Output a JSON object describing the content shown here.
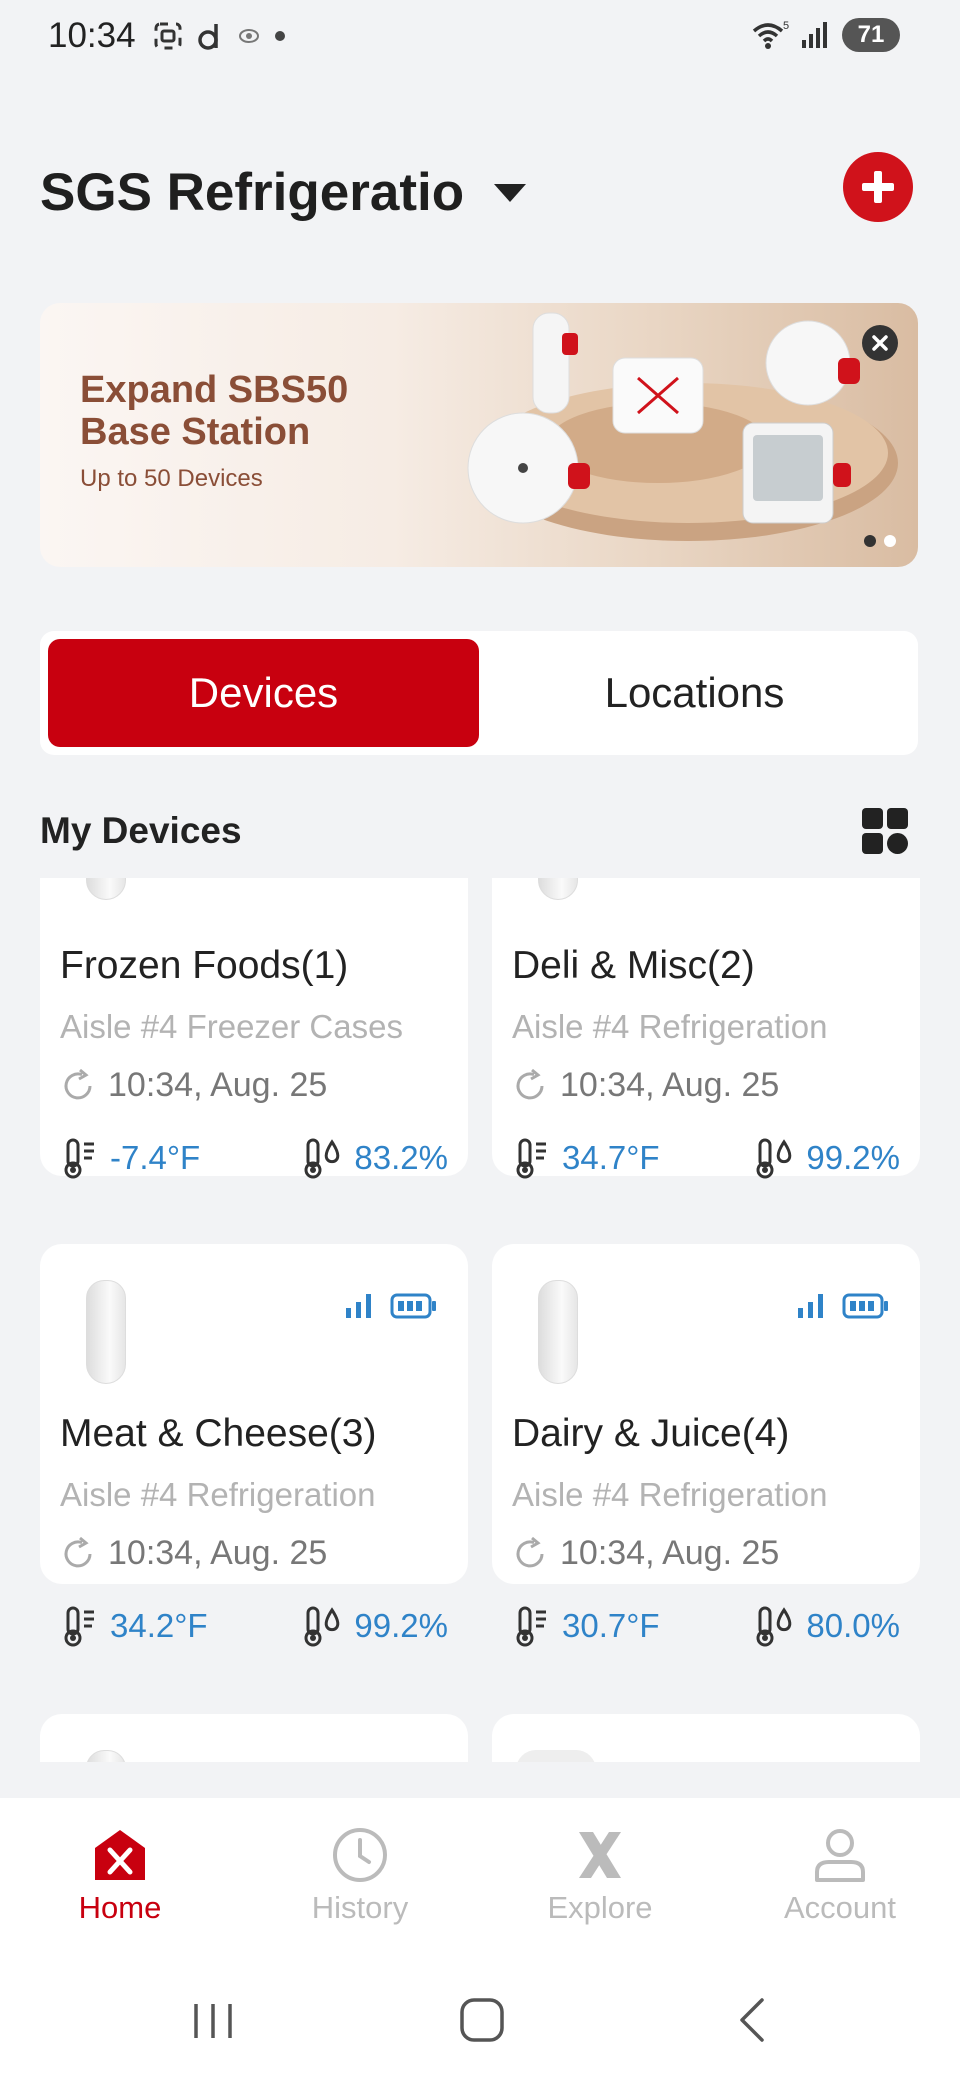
{
  "status_bar": {
    "time": "10:34",
    "battery": "71"
  },
  "header": {
    "title": "SGS Refrigeratio"
  },
  "banner": {
    "title": "Expand SBS50\nBase Station",
    "subtitle": "Up to 50 Devices"
  },
  "tabs": [
    {
      "label": "Devices",
      "active": true
    },
    {
      "label": "Locations",
      "active": false
    }
  ],
  "section": {
    "title": "My Devices"
  },
  "devices": [
    {
      "name": "Frozen Foods(1)",
      "location": "Aisle #4 Freezer Cases",
      "time": "10:34, Aug. 25",
      "temperature": "-7.4°F",
      "humidity": "83.2%"
    },
    {
      "name": "Deli & Misc(2)",
      "location": "Aisle #4 Refrigeration",
      "time": "10:34, Aug. 25",
      "temperature": "34.7°F",
      "humidity": "99.2%"
    },
    {
      "name": "Meat & Cheese(3)",
      "location": "Aisle #4 Refrigeration",
      "time": "10:34, Aug. 25",
      "temperature": "34.2°F",
      "humidity": "99.2%"
    },
    {
      "name": "Dairy & Juice(4)",
      "location": "Aisle #4 Refrigeration",
      "time": "10:34, Aug. 25",
      "temperature": "30.7°F",
      "humidity": "80.0%"
    }
  ],
  "bottom_nav": [
    {
      "label": "Home",
      "icon": "home-icon",
      "active": true
    },
    {
      "label": "History",
      "icon": "clock-icon",
      "active": false
    },
    {
      "label": "Explore",
      "icon": "x-logo-icon",
      "active": false
    },
    {
      "label": "Account",
      "icon": "person-icon",
      "active": false
    }
  ],
  "colors": {
    "accent": "#c8000f",
    "reading": "#2f83c8",
    "background": "#f2f3f5"
  }
}
